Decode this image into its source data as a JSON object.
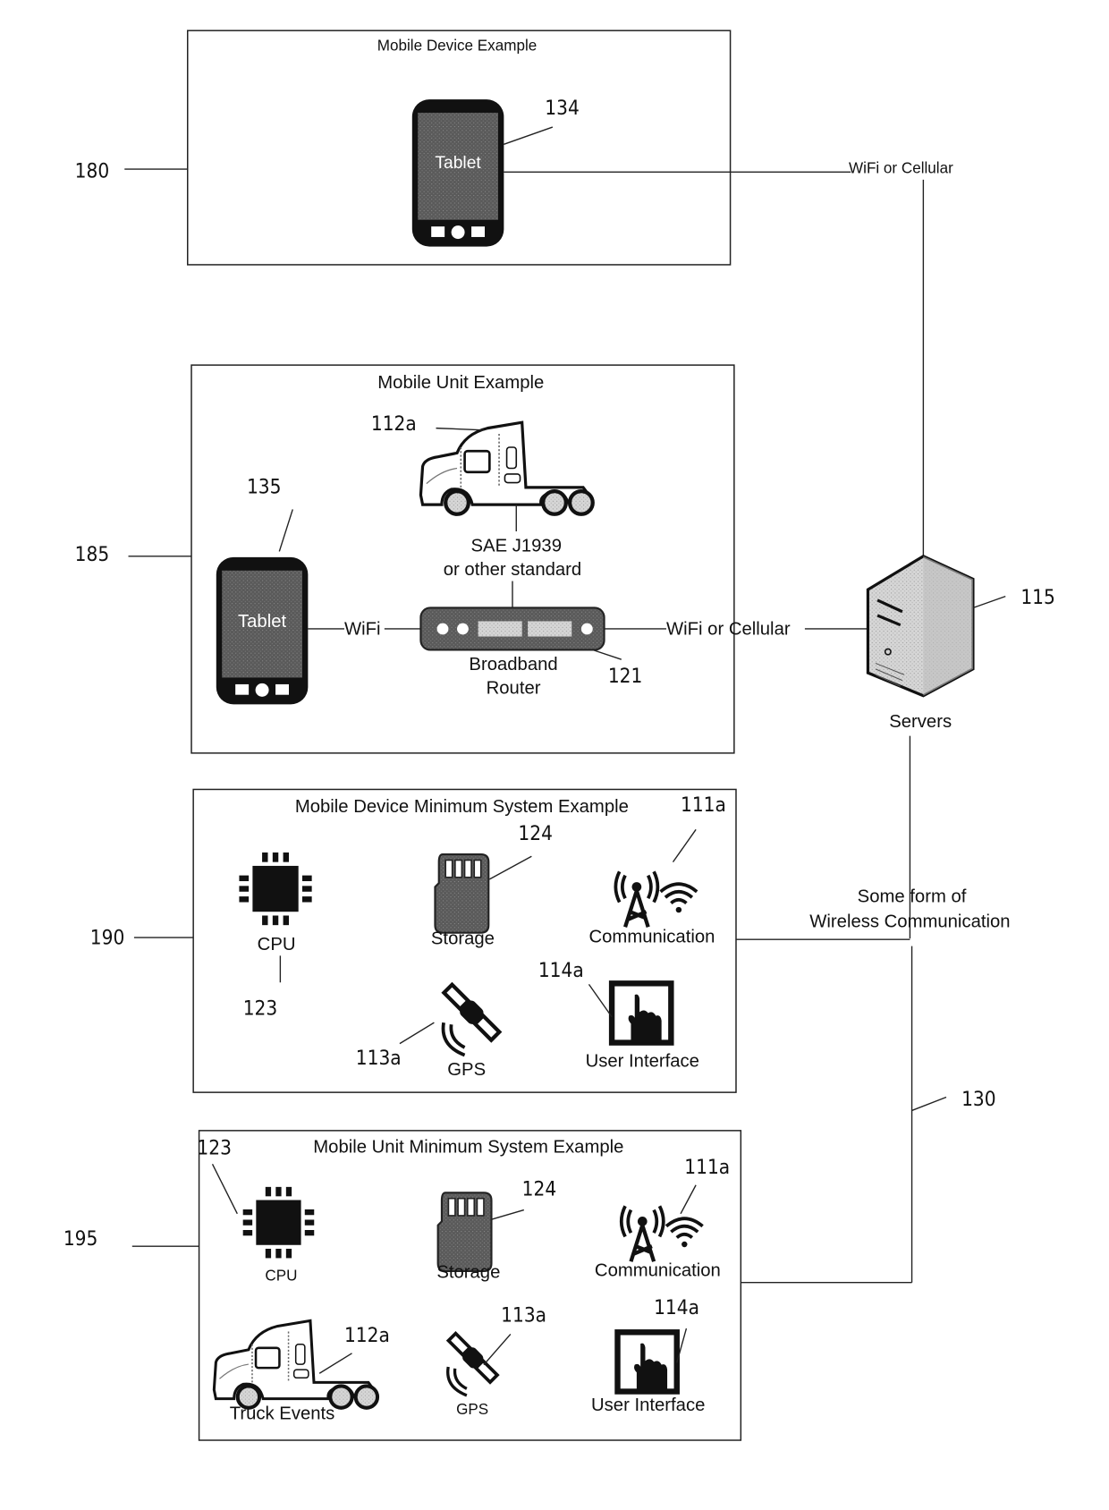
{
  "figure": {
    "sections": {
      "mobile_device": {
        "ref": "180",
        "title": "Mobile Device Example",
        "tablet": {
          "label": "Tablet",
          "ref": "134"
        },
        "link_label": "WiFi or Cellular"
      },
      "mobile_unit": {
        "ref": "185",
        "title": "Mobile Unit Example",
        "truck_ref": "112a",
        "tablet": {
          "label": "Tablet",
          "ref": "135"
        },
        "bus_label_line1": "SAE J1939",
        "bus_label_line2": "or other standard",
        "wifi_label": "WiFi",
        "router_label_line1": "Broadband",
        "router_label_line2": "Router",
        "router_ref": "121",
        "link_label": "WiFi or Cellular"
      },
      "mobile_device_min": {
        "ref": "190",
        "title": "Mobile Device Minimum System Example",
        "components": [
          {
            "name": "CPU",
            "ref": "123"
          },
          {
            "name": "Storage",
            "ref": "124"
          },
          {
            "name": "Communication",
            "ref": "111a"
          },
          {
            "name": "GPS",
            "ref": "113a"
          },
          {
            "name": "User Interface",
            "ref": "114a"
          }
        ]
      },
      "mobile_unit_min": {
        "ref": "195",
        "title": "Mobile Unit Minimum System Example",
        "components": [
          {
            "name": "CPU",
            "ref": "123"
          },
          {
            "name": "Storage",
            "ref": "124"
          },
          {
            "name": "Communication",
            "ref": "111a"
          },
          {
            "name": "Truck Events",
            "ref": "112a"
          },
          {
            "name": "GPS",
            "ref": "113a"
          },
          {
            "name": "User Interface",
            "ref": "114a"
          }
        ]
      }
    },
    "servers": {
      "label": "Servers",
      "ref": "115"
    },
    "wireless": {
      "label_line1": "Some form of",
      "label_line2": "Wireless Communication",
      "ref": "130"
    }
  }
}
